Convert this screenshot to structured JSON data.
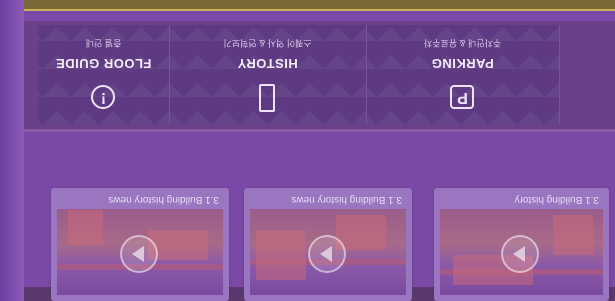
{
  "quick_links": [
    {
      "label": "PARKING",
      "sublabel": "주차안내 & 유료주차",
      "icon": "parking-icon"
    },
    {
      "label": "HISTORY",
      "sublabel": "스퀘어 역사 & 연혁보기",
      "icon": "building-icon"
    },
    {
      "label": "FLOOR GUIDE",
      "sublabel": "층별 안내",
      "icon": "info-icon"
    }
  ],
  "videos": [
    {
      "title": "3.1 Building history"
    },
    {
      "title": "3.1 Building history news"
    },
    {
      "title": "3.1 Building history news"
    }
  ],
  "colors": {
    "overlay": "#7b4aa8",
    "band": "#6a4088",
    "accent": "#c8b45a"
  }
}
